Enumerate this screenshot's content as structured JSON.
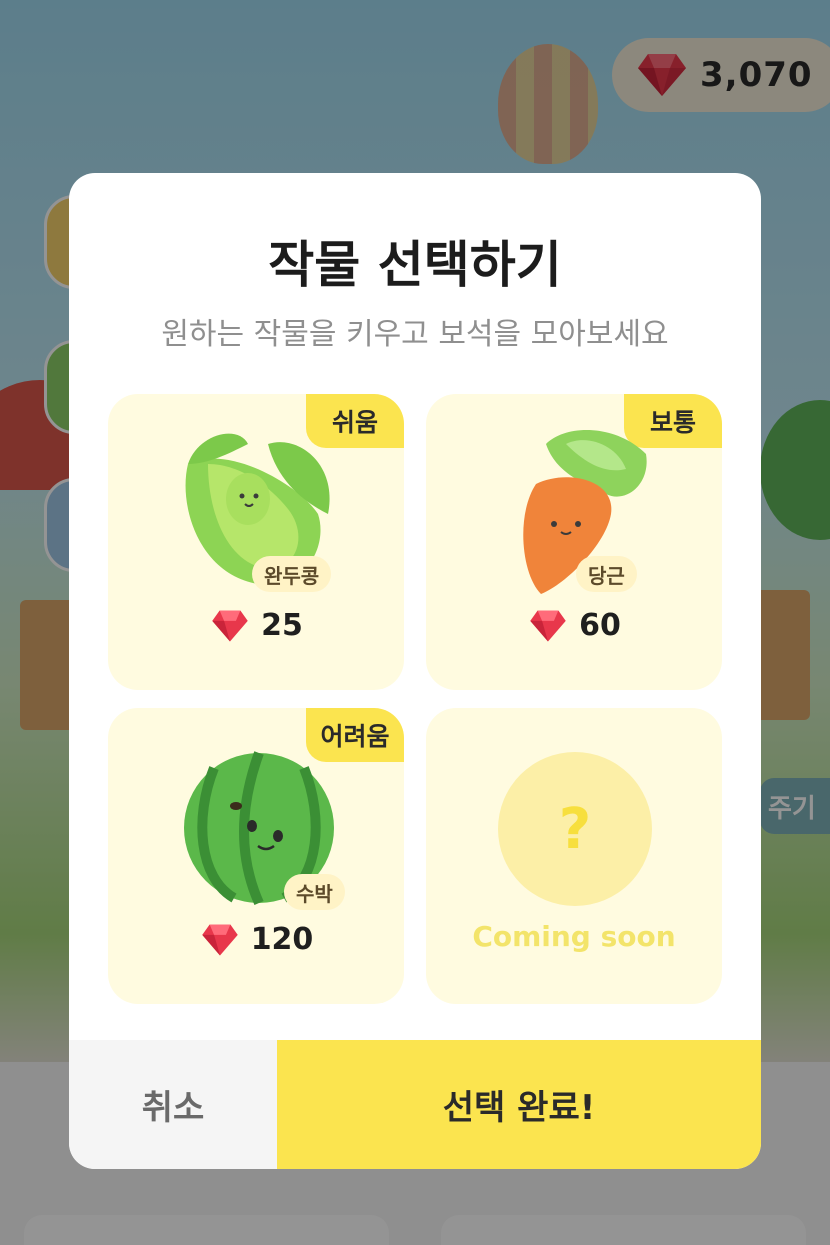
{
  "header": {
    "gem_count": "3,070",
    "gem_icon": "ruby-gem-icon"
  },
  "background": {
    "side_peek_label": "주기"
  },
  "modal": {
    "title": "작물 선택하기",
    "subtitle": "원하는 작물을 키우고 보석을 모아보세요",
    "crops": [
      {
        "difficulty": "쉬움",
        "name": "완두콩",
        "price": "25",
        "icon": "pea-pod-icon"
      },
      {
        "difficulty": "보통",
        "name": "당근",
        "price": "60",
        "icon": "carrot-icon"
      },
      {
        "difficulty": "어려움",
        "name": "수박",
        "price": "120",
        "icon": "watermelon-icon"
      }
    ],
    "coming_soon": {
      "symbol": "?",
      "label": "Coming soon"
    },
    "cancel_label": "취소",
    "confirm_label": "선택 완료!"
  },
  "colors": {
    "accent_yellow": "#fbe44f",
    "card_bg": "#fffbe0",
    "gem_red": "#e8374b"
  }
}
